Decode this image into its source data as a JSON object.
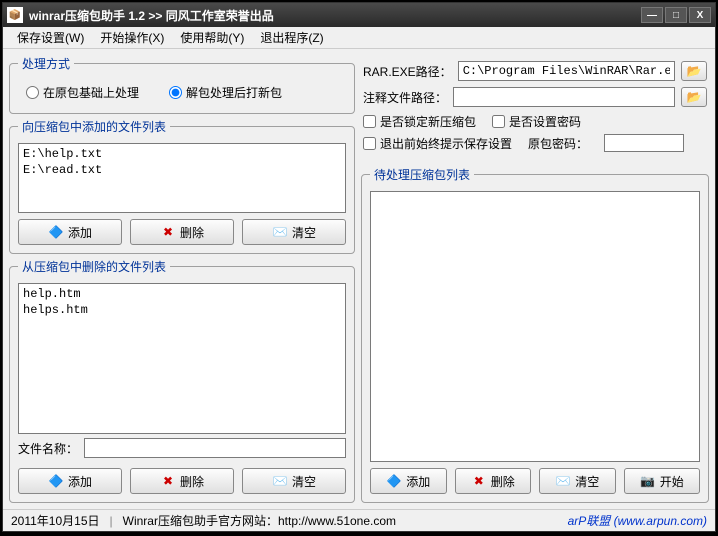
{
  "title": "winrar压缩包助手 1.2  >> 同风工作室荣誉出品",
  "menu": {
    "save": "保存设置(W)",
    "start": "开始操作(X)",
    "help": "使用帮助(Y)",
    "exit": "退出程序(Z)"
  },
  "process_mode": {
    "legend": "处理方式",
    "opt1": "在原包基础上处理",
    "opt2": "解包处理后打新包"
  },
  "add_list": {
    "legend": "向压缩包中添加的文件列表",
    "items": [
      "E:\\help.txt",
      "E:\\read.txt"
    ]
  },
  "del_list": {
    "legend": "从压缩包中删除的文件列表",
    "items": [
      "help.htm",
      "helps.htm"
    ]
  },
  "filename_label": "文件名称：",
  "buttons": {
    "add": "添加",
    "delete": "删除",
    "clear": "清空",
    "start": "开始"
  },
  "right": {
    "rar_label": "RAR.EXE路径：",
    "rar_value": "C:\\Program Files\\WinRAR\\Rar.exe",
    "comment_label": "注释文件路径：",
    "comment_value": "",
    "chk_lock": "是否锁定新压缩包",
    "chk_pwd": "是否设置密码",
    "chk_prompt": "退出前始终提示保存设置",
    "pwd_label": "原包密码：",
    "pending_legend": "待处理压缩包列表"
  },
  "status": {
    "date": "2011年10月15日",
    "site_label": "Winrar压缩包助手官方网站：http://www.51one.com",
    "brand_a": "arP联盟",
    "brand_b": "(www.arpun.com)"
  }
}
